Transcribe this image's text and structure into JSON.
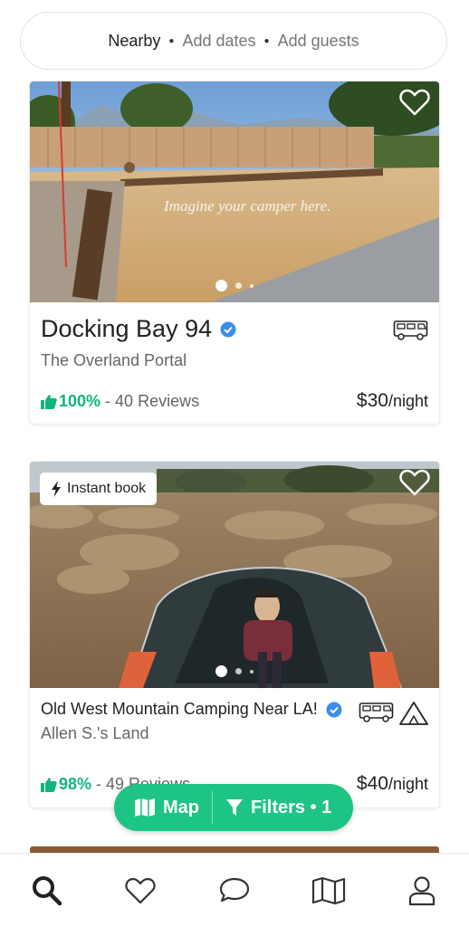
{
  "search": {
    "location": "Nearby",
    "dates": "Add dates",
    "guests": "Add guests"
  },
  "listings": [
    {
      "title": "Docking Bay 94",
      "host": "The Overland Portal",
      "rating_pct": "100%",
      "reviews": "- 40 Reviews",
      "price": "$30",
      "price_unit": "/night",
      "photo_caption": "Imagine your camper here.",
      "verified": true,
      "type_icons": [
        "rv-icon"
      ]
    },
    {
      "title": "Old West Mountain Camping Near LA!",
      "host": "Allen S.'s Land",
      "rating_pct": "98%",
      "reviews": "- 49 Reviews",
      "price": "$40",
      "price_unit": "/night",
      "badge": "Instant book",
      "verified": true,
      "type_icons": [
        "rv-icon",
        "tent-icon"
      ]
    }
  ],
  "floating": {
    "map_label": "Map",
    "filters_label": "Filters • 1"
  },
  "tabs": [
    "search-icon",
    "heart-icon",
    "chat-icon",
    "map-icon",
    "profile-icon"
  ],
  "colors": {
    "accent": "#1ec483",
    "rating": "#13b57a",
    "verified": "#3b8eea"
  }
}
